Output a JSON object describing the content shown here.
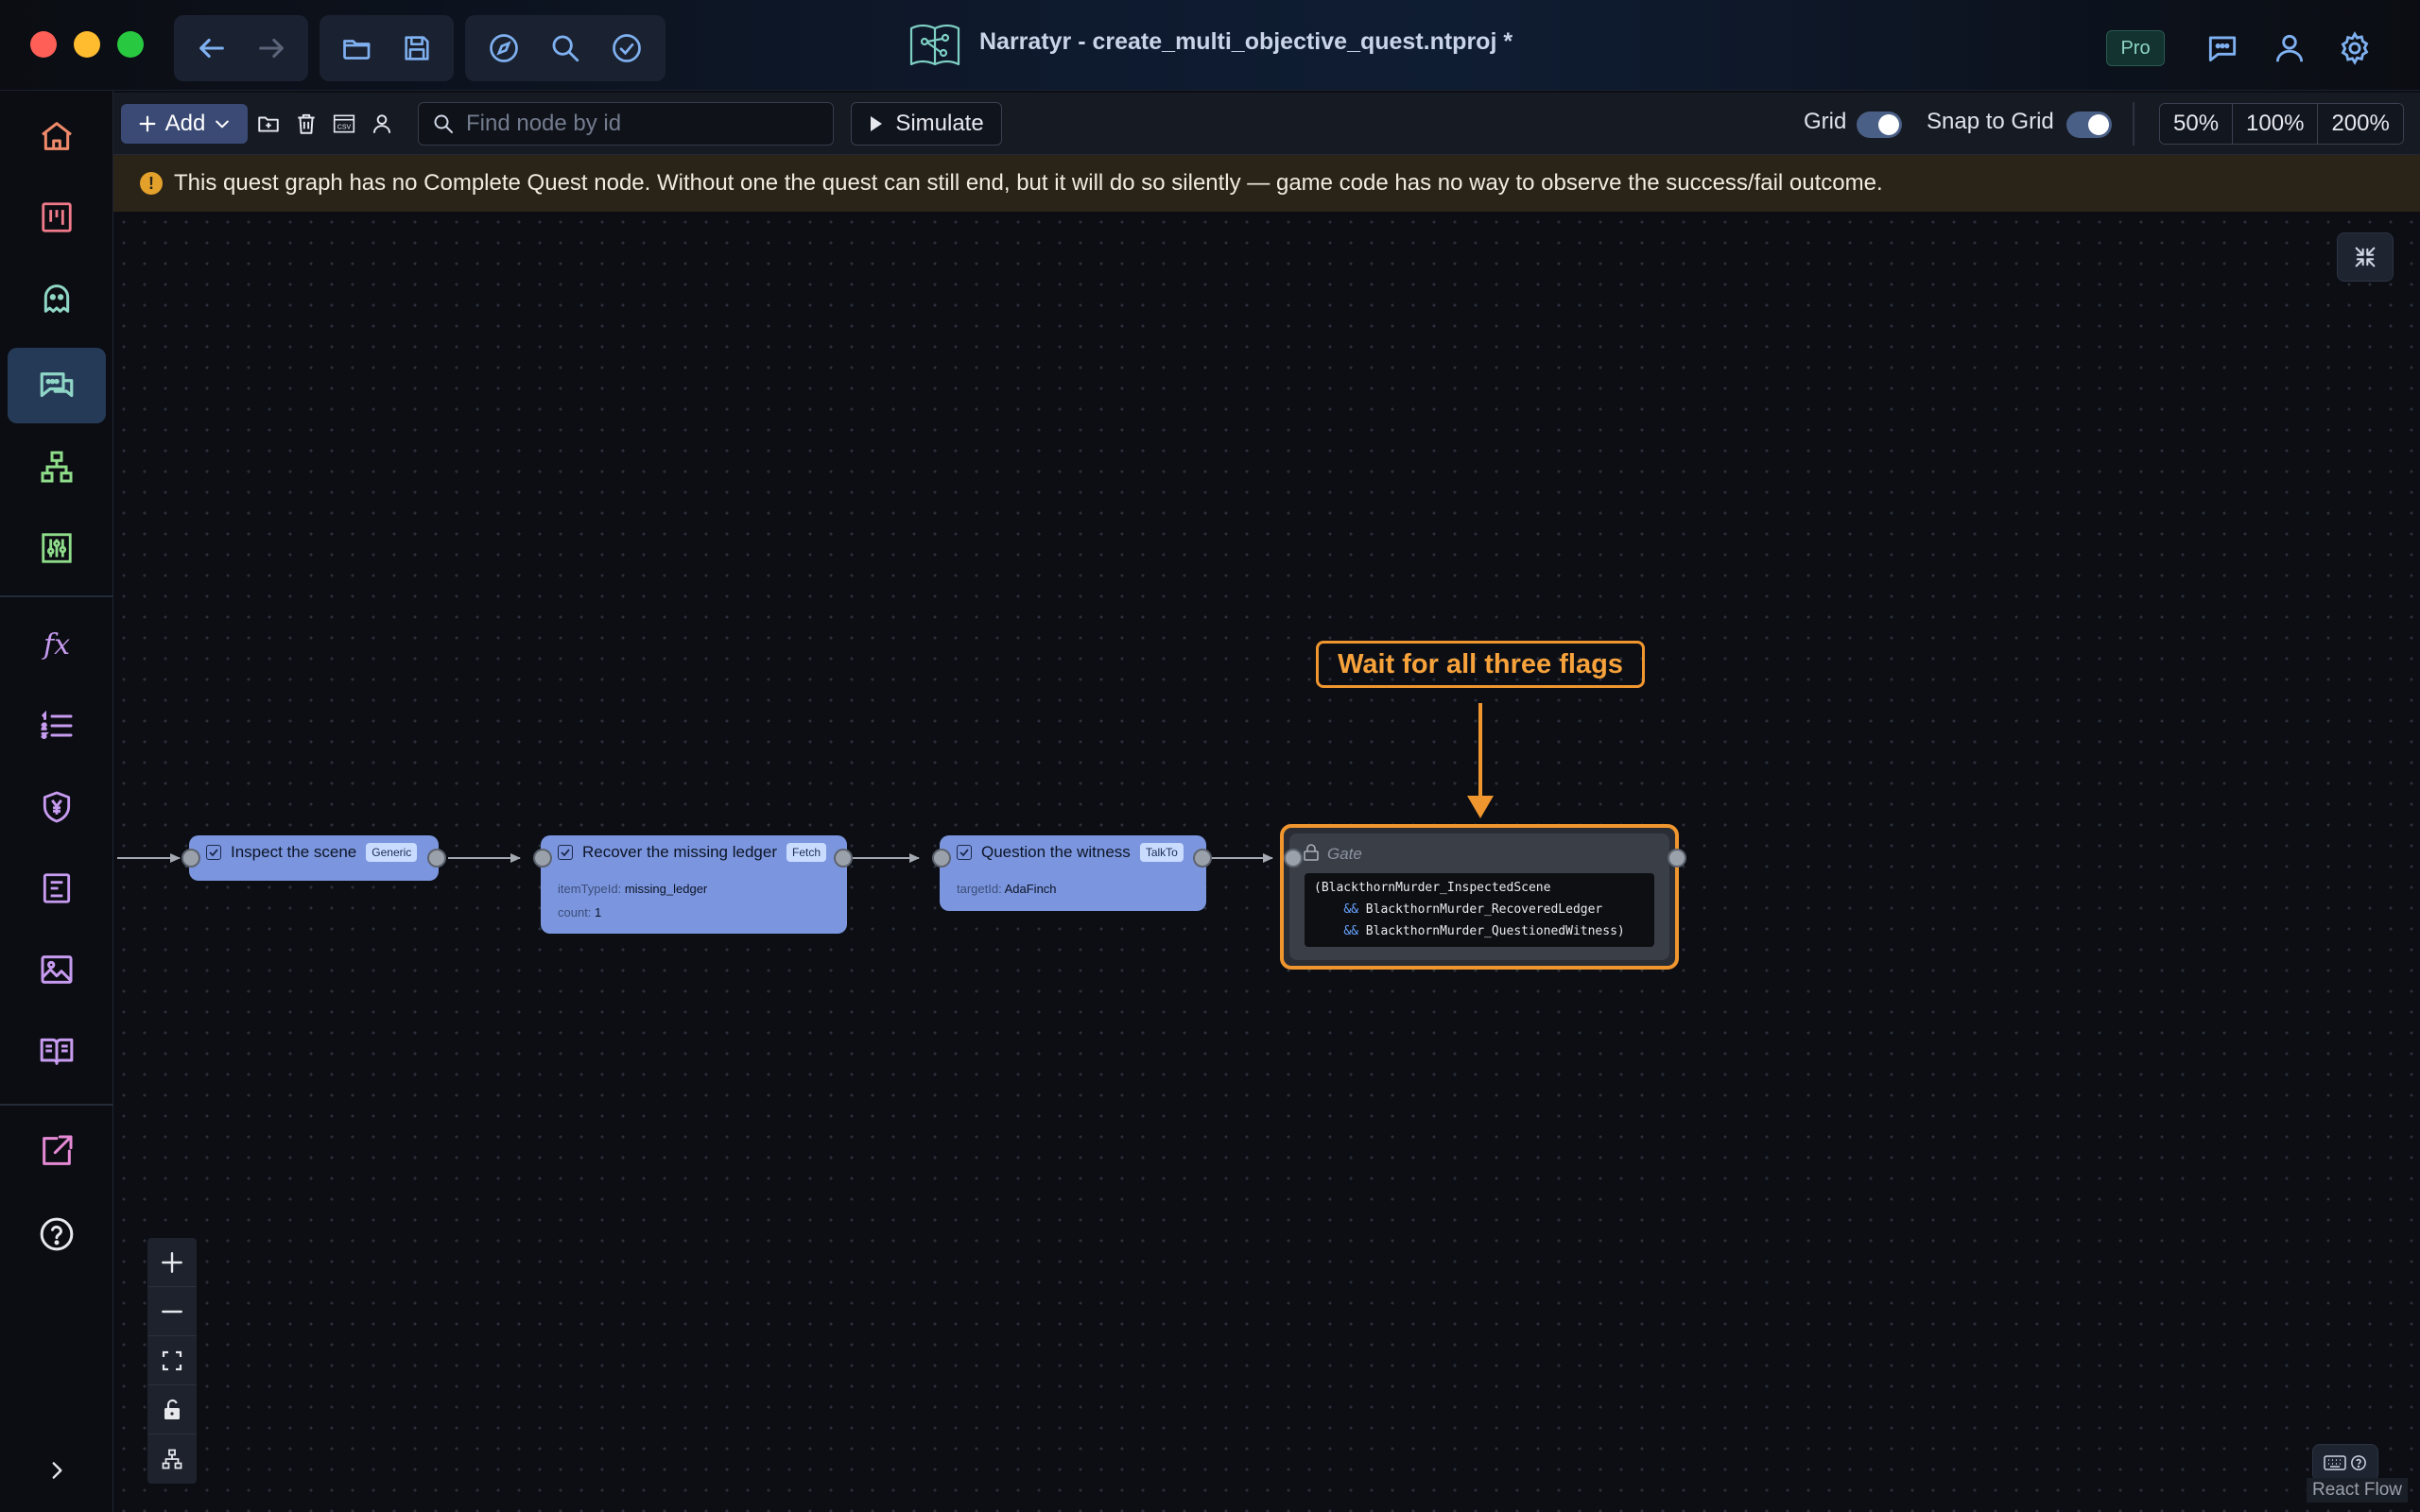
{
  "window": {
    "title": "Narratyr - create_multi_objective_quest.ntproj *",
    "plan_badge": "Pro"
  },
  "colors": {
    "accent": "#7b96de",
    "gate_highlight": "#f0962f",
    "warning_bg": "#2a2418",
    "warning_icon": "#e3a02b"
  },
  "titlebar": {
    "nav_icons": [
      "back-arrow-icon",
      "forward-arrow-icon"
    ],
    "file_icons": [
      "open-folder-icon",
      "save-icon"
    ],
    "tool_icons": [
      "compass-icon",
      "search-icon",
      "check-circle-icon"
    ],
    "right_icons": [
      "chat-icon",
      "user-icon",
      "gear-icon"
    ]
  },
  "sidebar": {
    "items": [
      {
        "icon": "home-icon",
        "active": false
      },
      {
        "icon": "kanban-board-icon",
        "active": false
      },
      {
        "icon": "ghost-icon",
        "active": false
      },
      {
        "icon": "dialogue-chat-icon",
        "active": true
      },
      {
        "icon": "hierarchy-tree-icon",
        "active": false
      },
      {
        "icon": "sliders-icon",
        "active": false
      },
      {
        "icon": "function-fx-icon",
        "active": false
      },
      {
        "icon": "list-icon",
        "active": false
      },
      {
        "icon": "currency-shield-icon",
        "active": false
      },
      {
        "icon": "inventory-item-icon",
        "active": false
      },
      {
        "icon": "image-icon",
        "active": false
      },
      {
        "icon": "book-icon",
        "active": false
      },
      {
        "icon": "export-icon",
        "active": false
      },
      {
        "icon": "help-icon",
        "active": false
      }
    ],
    "fx_label": "fx"
  },
  "toolbar": {
    "add_label": "Add",
    "search_placeholder": "Find node by id",
    "simulate_label": "Simulate",
    "grid_label": "Grid",
    "grid_on": true,
    "snap_label": "Snap to Grid",
    "snap_on": true,
    "zoom_options": [
      "50%",
      "100%",
      "200%"
    ]
  },
  "warning": {
    "text": "This quest graph has no Complete Quest node. Without one the quest can still end, but it will do so silently — game code has no way to observe the success/fail outcome.",
    "icon_glyph": "!"
  },
  "nodes": [
    {
      "title": "Inspect the scene",
      "badge": "Generic",
      "props": []
    },
    {
      "title": "Recover the missing ledger",
      "badge": "Fetch",
      "props": [
        {
          "key": "itemTypeId:",
          "value": "missing_ledger"
        },
        {
          "key": "count:",
          "value": "1"
        }
      ]
    },
    {
      "title": "Question the witness",
      "badge": "TalkTo",
      "props": [
        {
          "key": "targetId:",
          "value": "AdaFinch"
        }
      ]
    }
  ],
  "gate": {
    "title": "Gate",
    "expr_line1": "(BlackthornMurder_InspectedScene",
    "expr_op": "&&",
    "expr_line2": "BlackthornMurder_RecoveredLedger",
    "expr_line3": "BlackthornMurder_QuestionedWitness",
    "expr_close": ")"
  },
  "callout": {
    "text": "Wait for all three flags"
  },
  "canvas_controls": [
    "zoom-in-icon",
    "zoom-out-icon",
    "fit-view-icon",
    "lock-icon",
    "auto-layout-icon"
  ],
  "attribution": "React Flow"
}
